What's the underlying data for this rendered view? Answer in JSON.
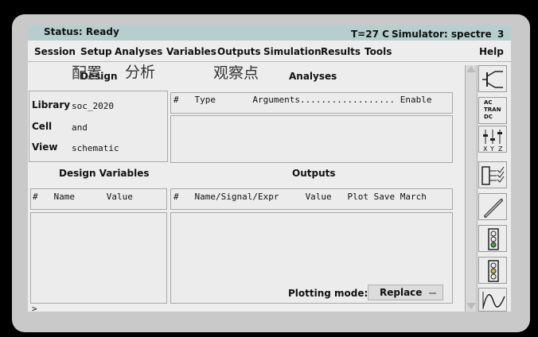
{
  "status": {
    "text": "Status: Ready",
    "temp": "T=27 C",
    "simulator": "Simulator: spectre",
    "number": "3"
  },
  "menu": [
    "Session",
    "Setup",
    "Analyses",
    "Variables",
    "Outputs",
    "Simulation",
    "Results",
    "Tools",
    "Help"
  ],
  "overlay": {
    "peizhi": "配置",
    "fenxi": "分析",
    "guancha": "观察点"
  },
  "design": {
    "title": "Design",
    "library_label": "Library",
    "library": "soc_2020",
    "cell_label": "Cell",
    "cell": "and",
    "view_label": "View",
    "view": "schematic"
  },
  "analyses": {
    "title": "Analyses",
    "header": "#   Type       Arguments.................. Enable"
  },
  "design_variables": {
    "title": "Design Variables",
    "header": "#   Name      Value"
  },
  "outputs": {
    "title": "Outputs",
    "header": "#   Name/Signal/Expr     Value   Plot Save March"
  },
  "plotting": {
    "label": "Plotting mode:",
    "value": "Replace"
  },
  "prompt": ">",
  "toolbar": {
    "ac": "AC",
    "tran": "TRAN",
    "dc": "DC",
    "x": "X",
    "y": "Y",
    "z": "Z"
  }
}
